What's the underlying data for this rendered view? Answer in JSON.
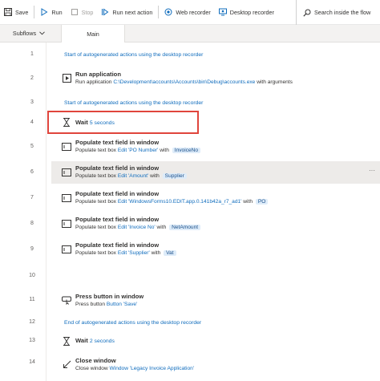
{
  "toolbar": {
    "save_label": "Save",
    "run_label": "Run",
    "stop_label": "Stop",
    "run_next_label": "Run next action",
    "web_recorder_label": "Web recorder",
    "desktop_recorder_label": "Desktop recorder",
    "search_label": "Search inside the flow"
  },
  "tabs": {
    "subflows_label": "Subflows",
    "main_label": "Main"
  },
  "flow": {
    "lines": {
      "l1": "1",
      "l2": "2",
      "l3": "3",
      "l4": "4",
      "l5": "5",
      "l6": "6",
      "l7": "7",
      "l8": "8",
      "l9": "9",
      "l10": "10",
      "l11": "11",
      "l12": "12",
      "l13": "13",
      "l14": "14"
    },
    "comment1": "Start of autogenerated actions using the desktop recorder",
    "run_app": {
      "title": "Run application",
      "desc_prefix": "Run application",
      "path": "C:\\Development\\accounts\\Accounts\\bin\\Debug\\accounts.exe",
      "desc_suffix": "with arguments"
    },
    "comment2": "Start of autogenerated actions using the desktop recorder",
    "wait1": {
      "title": "Wait",
      "value": "5 seconds"
    },
    "pop1": {
      "title": "Populate text field in window",
      "prefix": "Populate text box",
      "target": "Edit 'PO Number'",
      "with": "with",
      "var": "InvoiceNo"
    },
    "pop2": {
      "title": "Populate text field in window",
      "prefix": "Populate text box",
      "target": "Edit 'Amount'",
      "with": "with",
      "var": "Supplier"
    },
    "pop3": {
      "title": "Populate text field in window",
      "prefix": "Populate text box",
      "target": "Edit 'WindowsForms10.EDIT.app.0.141b42a_r7_ad1'",
      "with": "with",
      "var": "PO"
    },
    "pop4": {
      "title": "Populate text field in window",
      "prefix": "Populate text box",
      "target": "Edit 'Invoice No'",
      "with": "with",
      "var": "NetAmount"
    },
    "pop5": {
      "title": "Populate text field in window",
      "prefix": "Populate text box",
      "target": "Edit 'Supplier'",
      "with": "with",
      "var": "Vat"
    },
    "press": {
      "title": "Press button in window",
      "prefix": "Press button",
      "target": "Button 'Save'"
    },
    "comment3": "End of autogenerated actions using the desktop recorder",
    "wait2": {
      "title": "Wait",
      "value": "2 seconds"
    },
    "close": {
      "title": "Close window",
      "prefix": "Close window",
      "target": "Window 'Legacy Invoice Application'"
    },
    "more_label": "···"
  },
  "colors": {
    "link": "#0f6cbd",
    "highlight_box": "#e0453c",
    "variable_tag_bg": "#deecf9",
    "selected_row_bg": "#edebe9"
  },
  "icons": [
    "save-icon",
    "play-icon",
    "stop-icon",
    "run-next-icon",
    "web-recorder-icon",
    "desktop-recorder-icon",
    "search-icon",
    "chevron-down-icon",
    "run-application-icon",
    "hourglass-icon",
    "text-field-icon",
    "press-button-icon",
    "close-window-icon",
    "more-icon"
  ]
}
